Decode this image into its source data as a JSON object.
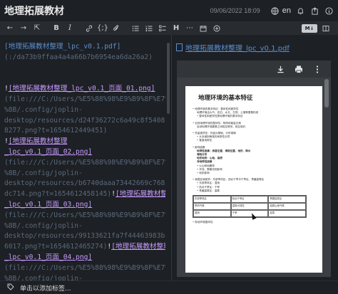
{
  "window": {
    "title": "地理拓展教材",
    "date": "09/06/2022 18:09",
    "language": "en"
  },
  "toolbar": {
    "back": "←",
    "forward": "→",
    "external_edit": "⇱",
    "bold": "B",
    "italic": "I",
    "link": "🔗",
    "code": "{;}",
    "attach": "📎",
    "bullet_list": "☰",
    "numbered_list": "☷",
    "checklist": "☑",
    "heading": "H",
    "hr": "⋯",
    "insert_datetime": "⊞",
    "insert_more": "⊕",
    "toggle_label": "M↓"
  },
  "editor": {
    "lines": [
      {
        "type": "link",
        "text": "[地理拓展教材整理_lpc_v0.1.pdf]"
      },
      {
        "type": "dim",
        "text": "(:/da73b9ffaa4a4a66b7b6954ea6da26a2)"
      },
      {
        "type": "gap",
        "text": ""
      },
      {
        "type": "gap",
        "text": ""
      },
      {
        "type": "img",
        "bang": "!",
        "text": "[地理拓展教材整理_lpc_v0.1_页面_01.png]"
      },
      {
        "type": "dim",
        "text": "(file:///C:/Users/%E5%88%98%E9%B9%8F%E7%A8"
      },
      {
        "type": "dim",
        "text": "%8B/.config/joplin-"
      },
      {
        "type": "dim",
        "text": "desktop/resources/d24f36272c6a49c8f540813bb7"
      },
      {
        "type": "dim",
        "text": "8277.png?t=1654612449451)"
      },
      {
        "type": "img",
        "bang": "!",
        "text": "[地理拓展教材整理"
      },
      {
        "type": "img",
        "bang": "",
        "text": "_lpc_v0.1_页面_02.png]"
      },
      {
        "type": "dim",
        "text": "(file:///C:/Users/%E5%88%98%E9%B9%8F%E7%A8"
      },
      {
        "type": "dim",
        "text": "%8B/.config/joplin-"
      },
      {
        "type": "dim",
        "text": "desktop/resources/b6740daaa73442669c7683cd3b6"
      },
      {
        "type": "mix",
        "dim": "dc714.png?t=1654612458145)",
        "bang": "!",
        "text": "[地理拓展教材整理"
      },
      {
        "type": "img",
        "bang": "",
        "text": "_lpc_v0.1_页面_03.png]"
      },
      {
        "type": "dim",
        "text": "(file:///C:/Users/%E5%88%98%E9%B9%8F%E7%A8"
      },
      {
        "type": "dim",
        "text": "%8B/.config/joplin-"
      },
      {
        "type": "dim",
        "text": "desktop/resources/99133621fa7f44463983bd82552af"
      },
      {
        "type": "mix",
        "dim": "6017.png?t=1654612465274)",
        "bang": "!",
        "text": "[地理拓展教材整理"
      },
      {
        "type": "img",
        "bang": "",
        "text": "_lpc_v0.1_页面_04.png]"
      },
      {
        "type": "dim",
        "text": "(file:///C:/Users/%E5%88%98%E9%B9%8F%E7%A8"
      },
      {
        "type": "dim",
        "text": "%8B/.config/joplin-"
      }
    ]
  },
  "viewer": {
    "pdf_link": "地理拓展教材整理_lpc_v0.1.pdf",
    "pdf_toolbar": {
      "download": "⤓",
      "print": "⎙",
      "more": "⋮"
    },
    "page": {
      "title": "地理环境的基本特征",
      "rows": [
        {
          "cls": "",
          "text": "•  地理环境的基本特征：整体性和差异性"
        },
        {
          "cls": "ind",
          "text": "地理环境由大气、岩石、水文、生物、土壤等要素构成"
        },
        {
          "cls": "ind",
          "text": "•  整体性和差异性是地理环境的基本特征"
        },
        {
          "cls": "gap",
          "text": ""
        },
        {
          "cls": "",
          "text": "•  自然地理环境的整体性：物质和能量交换"
        },
        {
          "cls": "ind",
          "text": "自然地理环境要素之间相互联系、相互制约"
        },
        {
          "cls": "gap",
          "text": ""
        },
        {
          "cls": "",
          "text": "•  热量差异性：热量为基础，分布规律"
        },
        {
          "cls": "ind",
          "text": "•  从赤道到两极的地带性分异"
        },
        {
          "cls": "ind",
          "text": "•  垂直地带性"
        },
        {
          "cls": "gap",
          "text": ""
        },
        {
          "cls": "",
          "text": "•  影响因素"
        },
        {
          "cls": "b ind",
          "text": "地带性因素：纬度位置、海陆位置、地形、降水"
        },
        {
          "cls": "b ind",
          "text": "海陆分布"
        },
        {
          "cls": "b ind",
          "text": "地形地势：山地、高原"
        },
        {
          "cls": "b ind",
          "text": "非地带性因素"
        },
        {
          "cls": "ind",
          "text": "•  火山和地震带"
        },
        {
          "cls": "ind",
          "text": "•  洋流、寒暖流的影响"
        },
        {
          "cls": "ind",
          "text": "•  地形影响"
        },
        {
          "cls": "gap",
          "text": ""
        },
        {
          "cls": "",
          "text": "•  我国区域差异：东部季风区、西北干旱半干旱区、青藏高寒区"
        },
        {
          "cls": "ind",
          "text": "•  东部季风区：湿润"
        },
        {
          "cls": "ind",
          "text": "•  西北干旱区：干旱"
        },
        {
          "cls": "ind",
          "text": "•  青藏高寒区：高寒"
        }
      ],
      "table": [
        "东部季风区",
        "西北干旱区",
        "青藏高寒区",
        "季风气候",
        "温带大陆性",
        "高原山地气候",
        "湿润",
        "干旱",
        "高寒"
      ],
      "footer_row": "•  陆地环境整体性"
    }
  },
  "footer": {
    "tag_icon": "🏷",
    "tag_text": "单击以添加标签..."
  }
}
